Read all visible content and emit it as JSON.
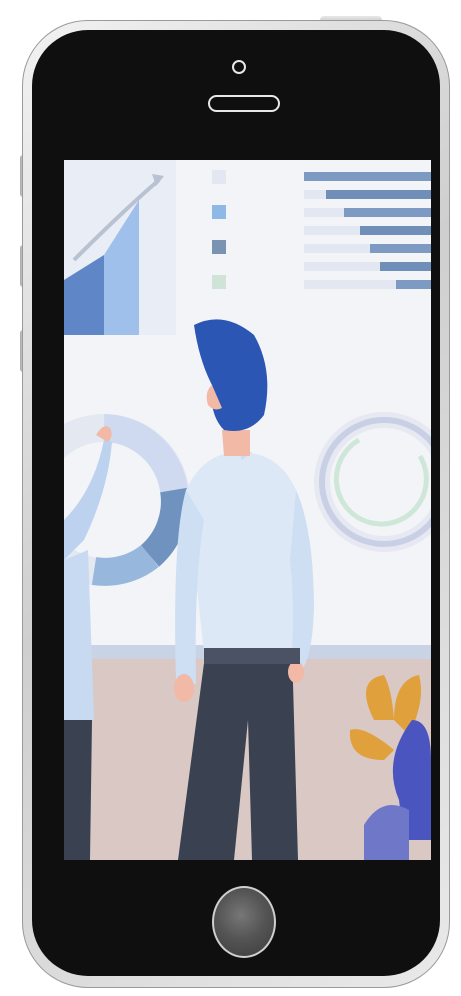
{
  "device": {
    "type": "smartphone",
    "frame_color": "#0f0f0f",
    "bezel_color": "#d9d9d9"
  },
  "screen": {
    "content": "illustration",
    "colors": {
      "background": "#f3f4f7",
      "floor": "#d9c8c4",
      "accent_blue": "#2b56b3",
      "shirt": "#dce8f6",
      "pants": "#3a4150",
      "plant_orange": "#e0a03c",
      "plant_purple": "#4b55c0"
    }
  },
  "icons": {
    "camera": "camera-icon",
    "speaker": "speaker-icon",
    "home": "home-button-icon"
  }
}
